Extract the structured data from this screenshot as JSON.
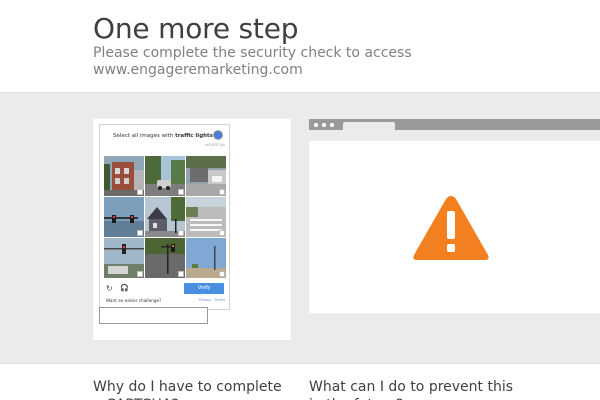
{
  "header": {
    "title": "One more step",
    "subtitle": "Please complete the security check to access www.engageremarketing.com"
  },
  "captcha": {
    "prompt_prefix": "Select all images with ",
    "prompt_target": "traffic lights",
    "logo_text": "reCAPTCHA",
    "verify_label": "Verify",
    "easier_label": "Want an easier challenge?",
    "privacy_label": "Privacy - Terms",
    "tiles": [
      "street-houses",
      "street-car",
      "street-suburb",
      "traffic-light-sky",
      "traffic-light-house",
      "crosswalk",
      "traffic-light-pole",
      "street-traffic-light",
      "sky-pole"
    ]
  },
  "colors": {
    "accent_verify": "#4a90e2",
    "warning": "#f38020",
    "band_background": "#ebebeb"
  },
  "faq": {
    "q1": "Why do I have to complete a CAPTCHA?",
    "q2": "What can I do to prevent this in the future?"
  }
}
